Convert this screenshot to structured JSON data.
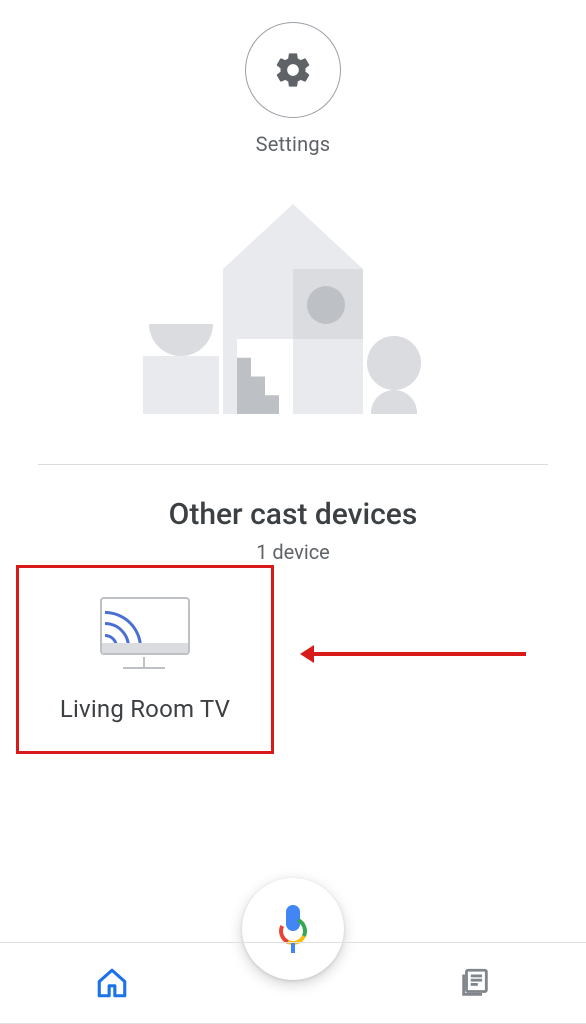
{
  "header": {
    "settings_label": "Settings"
  },
  "cast_section": {
    "title": "Other cast devices",
    "subtitle": "1 device"
  },
  "devices": [
    {
      "name": "Living Room TV"
    }
  ],
  "icons": {
    "gear": "gear-icon",
    "mic": "mic-icon",
    "home": "home-icon",
    "feed": "feed-icon",
    "cast": "cast-tv-icon"
  },
  "colors": {
    "accent_red": "#d81a1a",
    "home_active": "#1a73e8",
    "grey_icon": "#80868b"
  }
}
